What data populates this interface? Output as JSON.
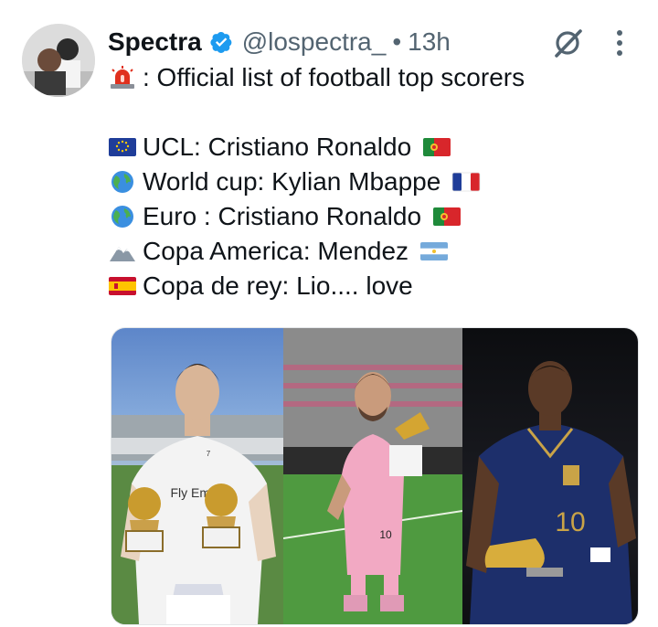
{
  "post": {
    "author_name": "Spectra",
    "handle": "@lospectra_",
    "separator": "•",
    "time": "13h",
    "verified": true,
    "lines": [
      {
        "icon": "siren-icon",
        "text": ": Official list of football top scorers"
      },
      {
        "icon": "eu-flag-icon",
        "text": "UCL: Cristiano Ronaldo",
        "flag": "portugal-flag-icon"
      },
      {
        "icon": "globe-icon",
        "text": "World cup: Kylian Mbappe",
        "flag": "france-flag-icon"
      },
      {
        "icon": "globe-icon",
        "text": "Euro : Cristiano Ronaldo",
        "flag": "portugal-flag-icon"
      },
      {
        "icon": "mountain-icon",
        "text": "Copa America: Mendez",
        "flag": "argentina-flag-icon"
      },
      {
        "icon": "spain-flag-icon",
        "text": "Copa de rey: Lio.... love"
      }
    ]
  },
  "media": {
    "panels": [
      "player-with-golden-balls-photo",
      "player-with-golden-boot-photo",
      "player-with-golden-boot-photo"
    ],
    "jersey_text": "Fly Emira",
    "jersey_number_left": "7",
    "jersey_number_mid": "10",
    "jersey_number_right": "10"
  },
  "colors": {
    "verified_blue": "#1d9bf0",
    "text": "#0f1419",
    "muted": "#536471"
  }
}
